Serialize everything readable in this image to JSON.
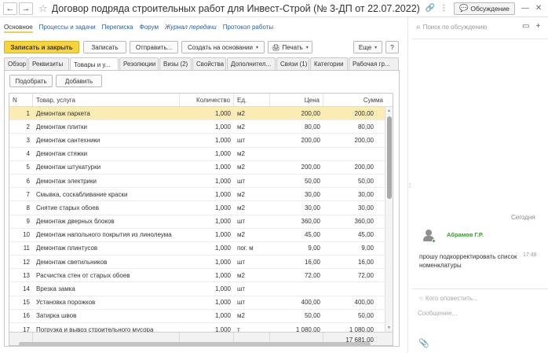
{
  "window": {
    "title": "Договор подряда строительных работ для Инвест-Строй (№ 3-ДП от 22.07.2022) (Внутре...",
    "back_icon": "←",
    "forward_icon": "→",
    "star_icon": "☆",
    "link_icon": "🔗",
    "more_icon": "⋮",
    "discussion_label": "Обсуждение",
    "discussion_icon": "💬",
    "minimize_icon": "—",
    "close_icon": "✕"
  },
  "nav": {
    "main": "Основное",
    "processes": "Процессы и задачи",
    "correspondence": "Переписка",
    "forum": "Форум",
    "log": "Журнал передачи",
    "protocol": "Протокол работы"
  },
  "toolbar": {
    "save_close": "Записать и закрыть",
    "save": "Записать",
    "send": "Отправить...",
    "create_based": "Создать на основании",
    "print": "Печать",
    "print_icon": "🖨",
    "more": "Еще",
    "help": "?",
    "dropdown_icon": "▾"
  },
  "tabs": [
    "Обзор",
    "Реквизиты",
    "Товары и у...",
    "Резолюции",
    "Визы (2)",
    "Свойства",
    "Дополнител...",
    "Связи (1)",
    "Категории",
    "Рабочая гр..."
  ],
  "subtoolbar": {
    "pick": "Подобрать",
    "add": "Добавить"
  },
  "table": {
    "headers": {
      "n": "N",
      "name": "Товар, услуга",
      "qty": "Количество",
      "unit": "Ед.",
      "price": "Цена",
      "sum": "Сумма"
    },
    "rows": [
      {
        "n": "1",
        "name": "Демонтаж паркета",
        "qty": "1,000",
        "unit": "м2",
        "price": "200,00",
        "sum": "200,00"
      },
      {
        "n": "2",
        "name": "Демонтаж плитки",
        "qty": "1,000",
        "unit": "м2",
        "price": "80,00",
        "sum": "80,00"
      },
      {
        "n": "3",
        "name": "Демонтаж сантехники",
        "qty": "1,000",
        "unit": "шт",
        "price": "200,00",
        "sum": "200,00"
      },
      {
        "n": "4",
        "name": "Демонтаж стяжки",
        "qty": "1,000",
        "unit": "м2",
        "price": "",
        "sum": ""
      },
      {
        "n": "5",
        "name": "Демонтаж штукатурки",
        "qty": "1,000",
        "unit": "м2",
        "price": "200,00",
        "sum": "200,00"
      },
      {
        "n": "6",
        "name": "Демонтаж электрики",
        "qty": "1,000",
        "unit": "шт",
        "price": "50,00",
        "sum": "50,00"
      },
      {
        "n": "7",
        "name": "Смывка, соскабливание краски",
        "qty": "1,000",
        "unit": "м2",
        "price": "30,00",
        "sum": "30,00"
      },
      {
        "n": "8",
        "name": "Снятие старых обоев",
        "qty": "1,000",
        "unit": "м2",
        "price": "30,00",
        "sum": "30,00"
      },
      {
        "n": "9",
        "name": "Демонтаж дверных блоков",
        "qty": "1,000",
        "unit": "шт",
        "price": "360,00",
        "sum": "360,00"
      },
      {
        "n": "10",
        "name": "Демонтаж напольного покрытия из линолеума",
        "qty": "1,000",
        "unit": "м2",
        "price": "45,00",
        "sum": "45,00"
      },
      {
        "n": "11",
        "name": "Демонтаж плинтусов",
        "qty": "1,000",
        "unit": "пог. м",
        "price": "9,00",
        "sum": "9,00"
      },
      {
        "n": "12",
        "name": "Демонтаж светильников",
        "qty": "1,000",
        "unit": "шт",
        "price": "16,00",
        "sum": "16,00"
      },
      {
        "n": "13",
        "name": "Расчистка стен от старых обоев",
        "qty": "1,000",
        "unit": "м2",
        "price": "72,00",
        "sum": "72,00"
      },
      {
        "n": "14",
        "name": "Врезка замка",
        "qty": "1,000",
        "unit": "шт",
        "price": "",
        "sum": ""
      },
      {
        "n": "15",
        "name": "Установка порожков",
        "qty": "1,000",
        "unit": "шт",
        "price": "400,00",
        "sum": "400,00"
      },
      {
        "n": "16",
        "name": "Затирка швов",
        "qty": "1,000",
        "unit": "м2",
        "price": "50,00",
        "sum": "50,00"
      },
      {
        "n": "17",
        "name": "Погрузка и вывоз строительного мусора",
        "qty": "1,000",
        "unit": "т",
        "price": "1 080,00",
        "sum": "1 080,00"
      }
    ],
    "total": "17 681,00",
    "scroll_up_icon": "▲",
    "scroll_down_icon": "▼"
  },
  "sidebar": {
    "search_placeholder": "Поиск по обсуждению",
    "search_icon": "⌕",
    "video_icon": "▭",
    "add_icon": "+",
    "splitter_icon": "⁞",
    "today": "Сегодня",
    "author": "Абрамов Г.Р.",
    "message": "прошу подкорректировать список номенклатуры",
    "time": "17:48",
    "notify_placeholder": "Кого оповестить...",
    "notify_icon": "○",
    "compose_placeholder": "Сообщение...",
    "attach_icon": "📎"
  }
}
